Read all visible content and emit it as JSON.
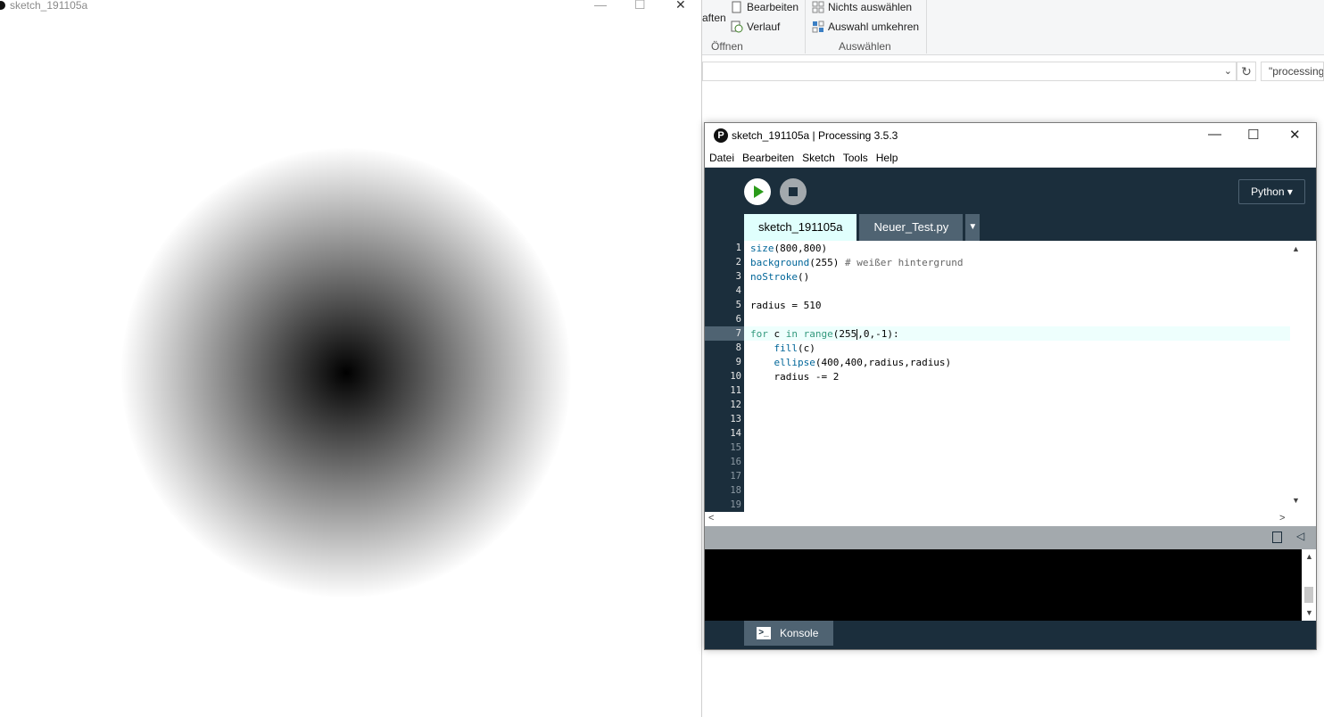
{
  "sketch_window": {
    "title": "sketch_191105a",
    "controls": [
      "—",
      "☐",
      "✕"
    ]
  },
  "explorer": {
    "ribbon": {
      "partial_label": "aften",
      "open_group": {
        "items": [
          "Bearbeiten",
          "Verlauf"
        ],
        "label": "Öffnen"
      },
      "select_group": {
        "items": [
          "Nichts auswählen",
          "Auswahl umkehren"
        ],
        "label": "Auswählen"
      }
    },
    "search_text": "\"processing"
  },
  "ide": {
    "title": "sketch_191105a | Processing 3.5.3",
    "window_controls": [
      "—",
      "☐",
      "✕"
    ],
    "menu": [
      "Datei",
      "Bearbeiten",
      "Sketch",
      "Tools",
      "Help"
    ],
    "mode": "Python ▾",
    "tabs": [
      {
        "label": "sketch_191105a",
        "active": true
      },
      {
        "label": "Neuer_Test.py",
        "active": false
      }
    ],
    "tab_menu_arrow": "▼",
    "line_numbers": [
      "1",
      "2",
      "3",
      "4",
      "5",
      "6",
      "7",
      "8",
      "9",
      "10",
      "11",
      "12",
      "13",
      "14",
      "15",
      "16",
      "17",
      "18",
      "19"
    ],
    "code": {
      "l1_fn": "size",
      "l1_rest": "(800,800)",
      "l2_fn": "background",
      "l2_rest": "(255) ",
      "l2_comment": "# weißer hintergrund",
      "l3_fn": "noStroke",
      "l3_rest": "()",
      "l5": "radius = 510",
      "l7_kw1": "for",
      "l7_var": " c ",
      "l7_kw2": "in",
      "l7_fn": " range",
      "l7_a": "(255",
      "l7_b": ",0,-1):",
      "l8_indent": "    ",
      "l8_fn": "fill",
      "l8_rest": "(c)",
      "l9_indent": "    ",
      "l9_fn": "ellipse",
      "l9_rest": "(400,400,radius,radius)",
      "l10": "    radius -= 2"
    },
    "console_tab_label": "Konsole",
    "console_icon": ">_"
  },
  "colors": {
    "ide_dark": "#1b2e3c",
    "tab_active": "#e0fffd",
    "run_green": "#2b9b1a",
    "keyword_blue": "#006699",
    "keyword_green": "#33997e"
  }
}
